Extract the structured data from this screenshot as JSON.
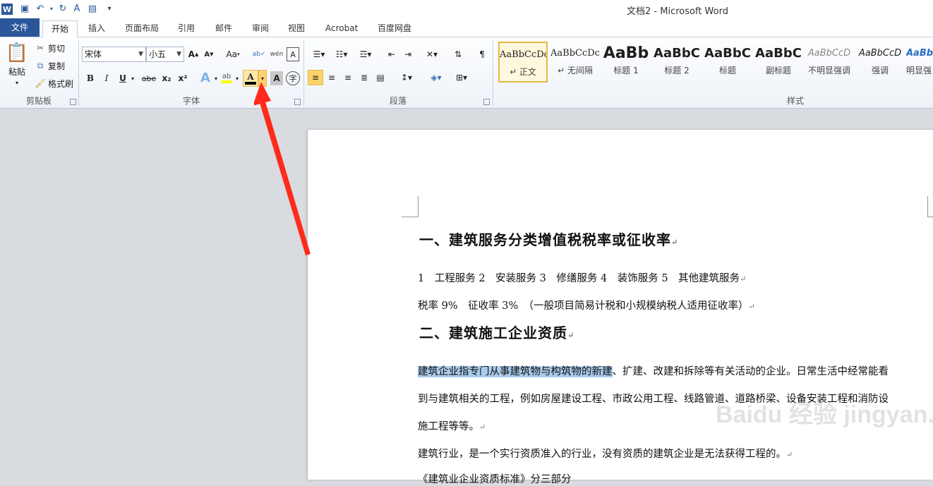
{
  "window": {
    "title": "文档2 - Microsoft Word"
  },
  "tabs": [
    "文件",
    "开始",
    "插入",
    "页面布局",
    "引用",
    "邮件",
    "审阅",
    "视图",
    "Acrobat",
    "百度网盘"
  ],
  "clipboard": {
    "paste": "粘贴",
    "cut": "剪切",
    "copy": "复制",
    "format_painter": "格式刷",
    "label": "剪贴板"
  },
  "font": {
    "name": "宋体",
    "size": "小五",
    "label": "字体",
    "case": "Aa",
    "bold": "B",
    "italic": "I",
    "underline": "U",
    "strike": "abe",
    "sub": "x₂",
    "sup": "x²",
    "color_letter": "A"
  },
  "paragraph": {
    "label": "段落"
  },
  "styles": {
    "label": "样式",
    "items": [
      {
        "sample": "AaBbCcDc",
        "name": "↵ 正文"
      },
      {
        "sample": "AaBbCcDc",
        "name": "↵ 无间隔"
      },
      {
        "sample": "AaBb",
        "name": "标题 1"
      },
      {
        "sample": "AaBbC",
        "name": "标题 2"
      },
      {
        "sample": "AaBbC",
        "name": "标题"
      },
      {
        "sample": "AaBbC",
        "name": "副标题"
      },
      {
        "sample": "AaBbCcD",
        "name": "不明显强调"
      },
      {
        "sample": "AaBbCcD",
        "name": "强调"
      },
      {
        "sample": "AaBb",
        "name": "明显强"
      }
    ]
  },
  "document": {
    "h1": "一、建筑服务分类增值税税率或征收率",
    "p1": "1　工程服务 2　安装服务 3　修缮服务 4　装饰服务 5　其他建筑服务",
    "p2": "税率 9%　征收率 3%　（一般项目简易计税和小规模纳税人适用征收率）",
    "h2": "二、建筑施工企业资质",
    "p3_selected": "建筑企业指专门从事建筑物与构筑物的新建",
    "p3_rest": "、扩建、改建和拆除等有关活动的企业。日常生活中经常能看",
    "p4": "到与建筑相关的工程，例如房屋建设工程、市政公用工程、线路管道、道路桥梁、设备安装工程和消防设",
    "p5": "施工程等等。",
    "p6": "建筑行业，是一个实行资质准入的行业，没有资质的建筑企业是无法获得工程的。",
    "p7": "《建筑业企业资质标准》分三部分"
  },
  "watermark": "Baidu 经验 jingyan.baidu.com",
  "colors": {
    "accent": "#2b579a",
    "arrow": "#ff2a1a",
    "font_color_bar": "#000000",
    "highlight_bar": "#ffff00"
  }
}
